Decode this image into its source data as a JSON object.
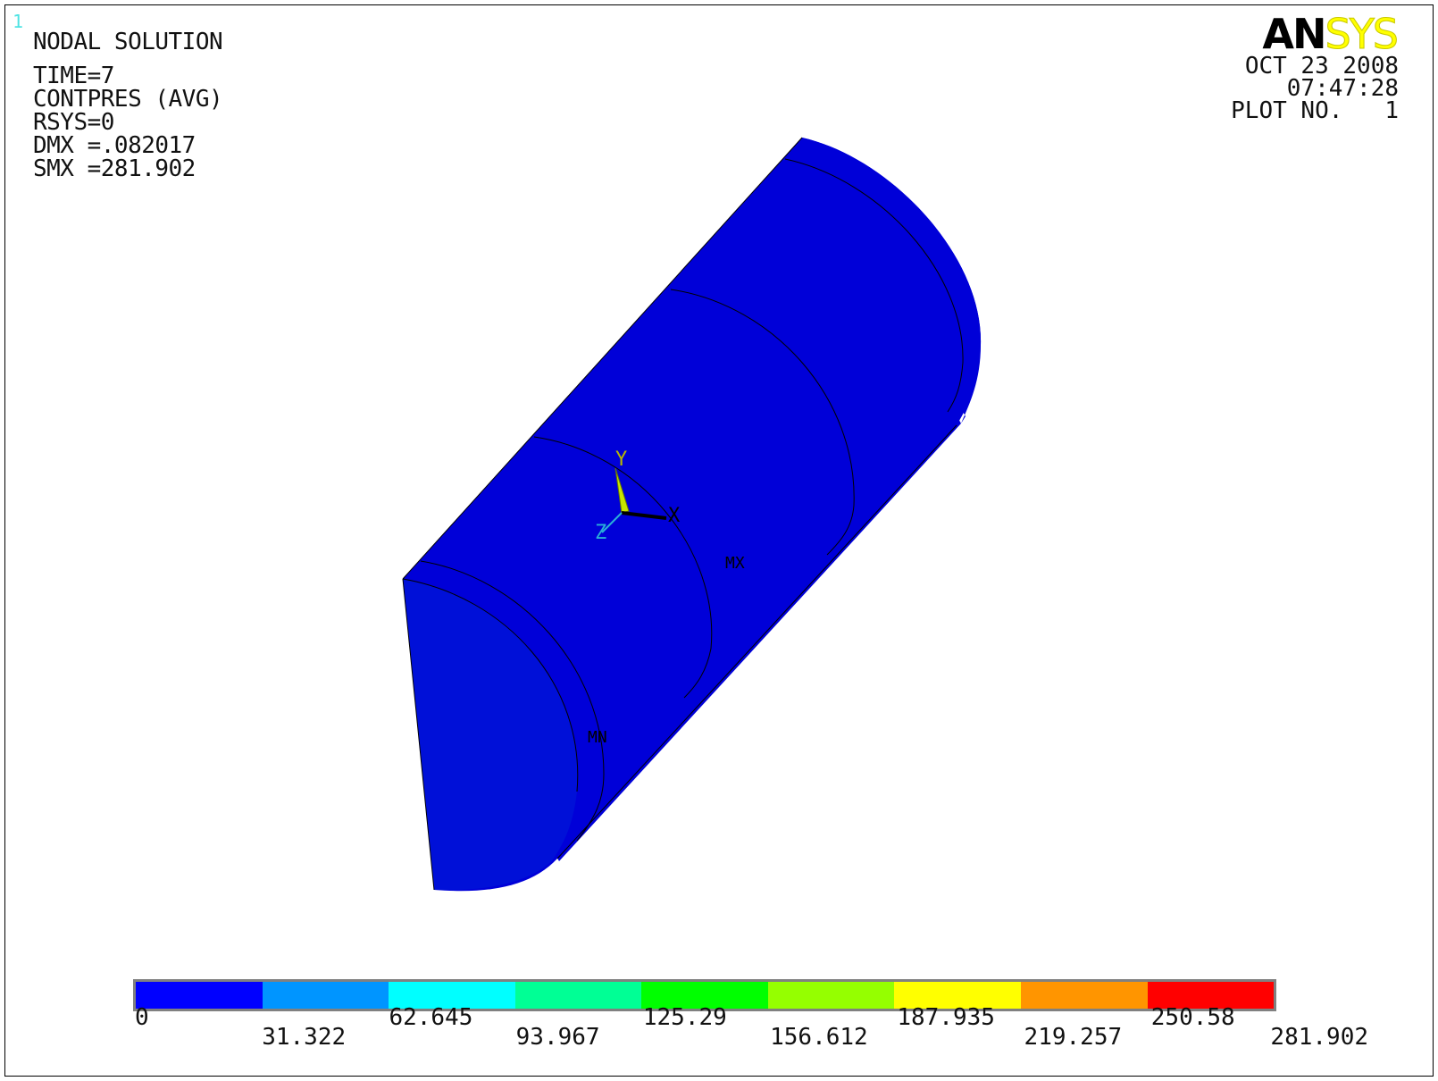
{
  "window_number": "1",
  "header": {
    "title": "NODAL SOLUTION",
    "lines": [
      "TIME=7",
      "CONTPRES (AVG)",
      "RSYS=0",
      "DMX =.082017",
      "SMX =281.902"
    ]
  },
  "brand": {
    "part1": "AN",
    "part2": "SYS"
  },
  "datetime": {
    "date": "OCT 23 2008",
    "time": "07:47:28",
    "plot": "PLOT NO.   1"
  },
  "axes": {
    "x": "X",
    "y": "Y",
    "z": "Z"
  },
  "markers": {
    "mx": "MX",
    "mn": "MN"
  },
  "legend": {
    "colors": [
      "#0000ff",
      "#0095ff",
      "#00ffff",
      "#00ff95",
      "#00ff00",
      "#95ff00",
      "#ffff00",
      "#ff9500",
      "#ff0000"
    ],
    "labels": [
      "0",
      "31.322",
      "62.645",
      "93.967",
      "125.29",
      "156.612",
      "187.935",
      "219.257",
      "250.58",
      "281.902"
    ]
  },
  "model_color": "#0000d8"
}
